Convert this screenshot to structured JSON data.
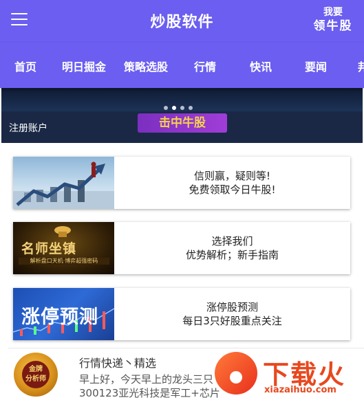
{
  "header": {
    "title": "炒股软件",
    "brand_line1": "我要",
    "brand_line2": "领牛股"
  },
  "nav": {
    "items": [
      "首页",
      "明日掘金",
      "策略选股",
      "行情",
      "快讯",
      "要闻",
      "邦"
    ]
  },
  "banner": {
    "register_label": "注册账户",
    "cta_label": "击中牛股",
    "slides": 4,
    "active_slide": 2
  },
  "cards": [
    {
      "line1": "信则赢，疑则等!",
      "line2": "免费领取今日牛股!"
    },
    {
      "line1": "选择我们",
      "line2": "优势解析；新手指南",
      "image_title": "名师坐镇",
      "image_subtitle": "解析盘口天机·博弈超强密码"
    },
    {
      "line1": "涨停股预测",
      "line2": "每日3只好股重点关注",
      "image_title": "涨停预测"
    }
  ],
  "news": {
    "medal_line1": "金牌",
    "medal_line2": "分析师",
    "heading": "行情快递丶精选",
    "line1": "早上好，今天早上的龙头三只",
    "line2": "300123亚光科技是军工+芯片"
  },
  "watermark": {
    "text": "下载火",
    "url": "xiazaihuo.com"
  },
  "colors": {
    "header_bg": "#6b5ef0",
    "cta_bg": "#a03dd8",
    "cta_text": "#f6d34b",
    "watermark": "#e8481e"
  }
}
